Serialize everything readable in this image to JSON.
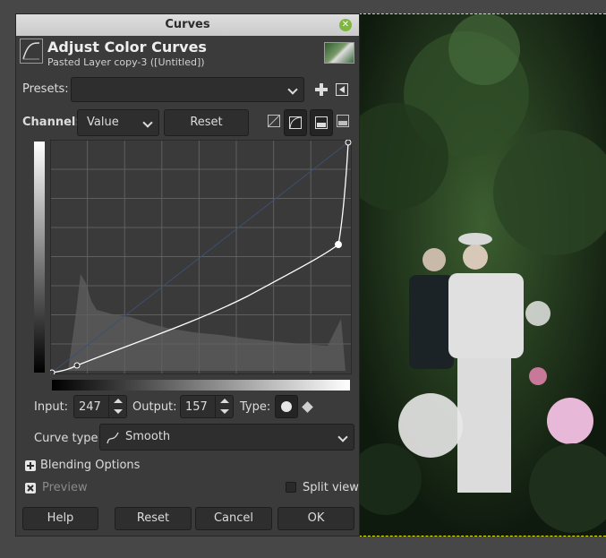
{
  "dialog": {
    "title": "Curves",
    "header_title": "Adjust Color Curves",
    "header_subtitle": "Pasted Layer copy-3 ([Untitled])"
  },
  "presets": {
    "label": "Presets:",
    "value": ""
  },
  "channel": {
    "label": "Channel:",
    "value": "Value",
    "reset_label": "Reset Channel"
  },
  "point": {
    "input_label": "Input:",
    "input_value": "247",
    "output_label": "Output:",
    "output_value": "157",
    "type_label": "Type:"
  },
  "curve_type": {
    "label": "Curve type:",
    "value": "Smooth"
  },
  "options": {
    "blending_label": "Blending Options",
    "preview_label": "Preview",
    "split_label": "Split view"
  },
  "buttons": {
    "help": "Help",
    "reset": "Reset",
    "cancel": "Cancel",
    "ok": "OK"
  },
  "colors": {
    "accent_green": "#7fb640",
    "selection_dash": "#e8e800"
  }
}
